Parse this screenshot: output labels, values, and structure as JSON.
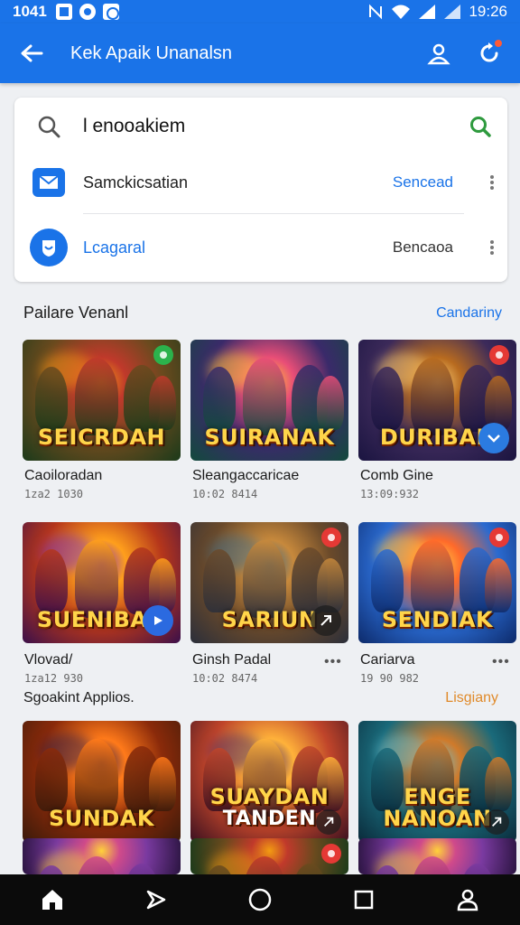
{
  "status": {
    "time": "1041",
    "clock": "19:26",
    "icons": [
      "image-notification-icon",
      "circle-app-icon",
      "badge-app-icon",
      "nfc-icon",
      "wifi-icon",
      "signal-icon",
      "signal-icon-2"
    ]
  },
  "appbar": {
    "title": "Kek Apaik Unanalsn",
    "color": "#1a73e8"
  },
  "search": {
    "value": "l enooakiem",
    "placeholder": ""
  },
  "options": [
    {
      "label": "Samckicsatian",
      "action": "Sencead",
      "action_color": "#1a73e8",
      "label_color": "#1e1e1e",
      "icon": "mail-icon"
    },
    {
      "label": "Lcagaral",
      "action": "Bencaoa",
      "action_color": "#333333",
      "label_color": "#1a73e8",
      "icon": "shield-icon"
    }
  ],
  "section1": {
    "heading": "Pailare Venanl",
    "link": "Candariny",
    "link_color": "#1a73e8"
  },
  "section2": {
    "heading": "Sgoakint Applios.",
    "link": "Lisgiany",
    "link_color": "#e08a2a"
  },
  "row1": [
    {
      "title": "Caoiloradan",
      "sub": "1za2 1030",
      "logo": "SEICRDAH",
      "theme": "jungle",
      "badge_color": "#2bb24c"
    },
    {
      "title": "Sleangaccaricae",
      "sub": "10:02 8414",
      "logo": "SUIRANAK",
      "theme": "tropic",
      "badge_color": ""
    },
    {
      "title": "Comb Gine",
      "sub": "13:09:932",
      "logo": "DURIBAN",
      "theme": "night",
      "badge_color": "#e53935"
    }
  ],
  "row2": [
    {
      "title": "Vlovad/",
      "sub": "1za12 930",
      "logo": "SUENIBAN",
      "theme": "fire",
      "badge_color": ""
    },
    {
      "title": "Ginsh Padal",
      "sub": "10:02 8474",
      "logo": "SARIUN",
      "theme": "dusk",
      "badge_color": "#e53935"
    },
    {
      "title": "Cariarva",
      "sub": "19 90 982",
      "logo": "SENDIAK",
      "theme": "storm",
      "badge_color": "#e53935"
    }
  ],
  "row3": [
    {
      "logo": "SUNDAK",
      "theme": "ember"
    },
    {
      "logo": "SUAYDAN",
      "logo2": "TANDEN",
      "theme": "sunset"
    },
    {
      "logo": "ENGE NANOAN",
      "theme": "teal"
    }
  ],
  "row4": [
    {
      "theme": "violet"
    },
    {
      "theme": "jungle",
      "badge_color": "#e53935"
    },
    {
      "theme": "violet"
    }
  ],
  "nav": [
    "home-icon",
    "cast-icon",
    "circle-home-icon",
    "square-recent-icon",
    "profile-icon"
  ]
}
